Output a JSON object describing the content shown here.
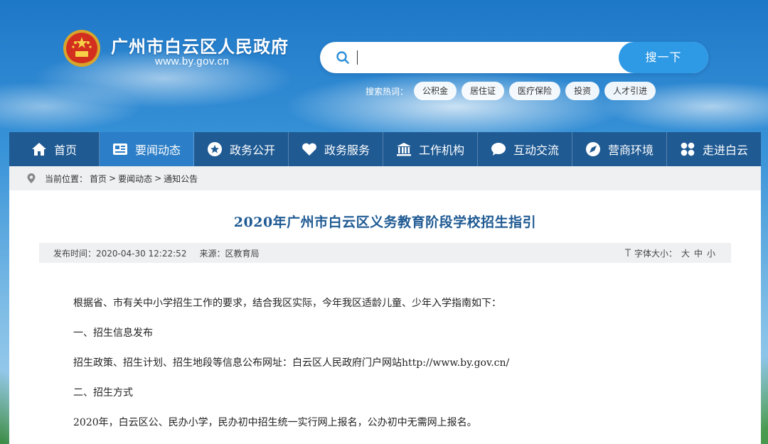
{
  "header": {
    "site_title": "广州市白云区人民政府",
    "site_url": "www.by.gov.cn",
    "search": {
      "placeholder": "",
      "button_label": "搜一下"
    },
    "hot_words": {
      "label": "搜索热词：",
      "tags": [
        "公积金",
        "居住证",
        "医疗保险",
        "投资",
        "人才引进"
      ]
    }
  },
  "nav": {
    "items": [
      {
        "label": "首页",
        "icon": "home-icon"
      },
      {
        "label": "要闻动态",
        "icon": "news-icon",
        "active": true
      },
      {
        "label": "政务公开",
        "icon": "star-icon"
      },
      {
        "label": "政务服务",
        "icon": "heart-icon"
      },
      {
        "label": "工作机构",
        "icon": "building-icon"
      },
      {
        "label": "互动交流",
        "icon": "chat-icon"
      },
      {
        "label": "营商环境",
        "icon": "compass-icon"
      },
      {
        "label": "走进白云",
        "icon": "grid-icon"
      }
    ]
  },
  "breadcrumb": {
    "label": "当前位置：",
    "items": [
      "首页",
      ">",
      "要闻动态",
      ">",
      "通知公告"
    ]
  },
  "article": {
    "title": "2020年广州市白云区义务教育阶段学校招生指引",
    "publish_time": "发布时间：2020-04-30 12:22:52",
    "source": "来源：区教育局",
    "font_size_label": "字体大小：",
    "font_sizes": [
      "大",
      "中",
      "小"
    ],
    "paragraphs": [
      "根据省、市有关中小学招生工作的要求，结合我区实际，今年我区适龄儿童、少年入学指南如下：",
      "一、招生信息发布",
      "招生政策、招生计划、招生地段等信息公布网址：白云区人民政府门户网站http://www.by.gov.cn/",
      "二、招生方式",
      "2020年，白云区公、民办小学，民办初中招生统一实行网上报名，公办初中无需网上报名。"
    ]
  },
  "colors": {
    "nav_bg": "#1f5a93",
    "nav_active": "#2b7ec7",
    "search_button": "#2e9ae6",
    "title": "#1f5a93"
  }
}
